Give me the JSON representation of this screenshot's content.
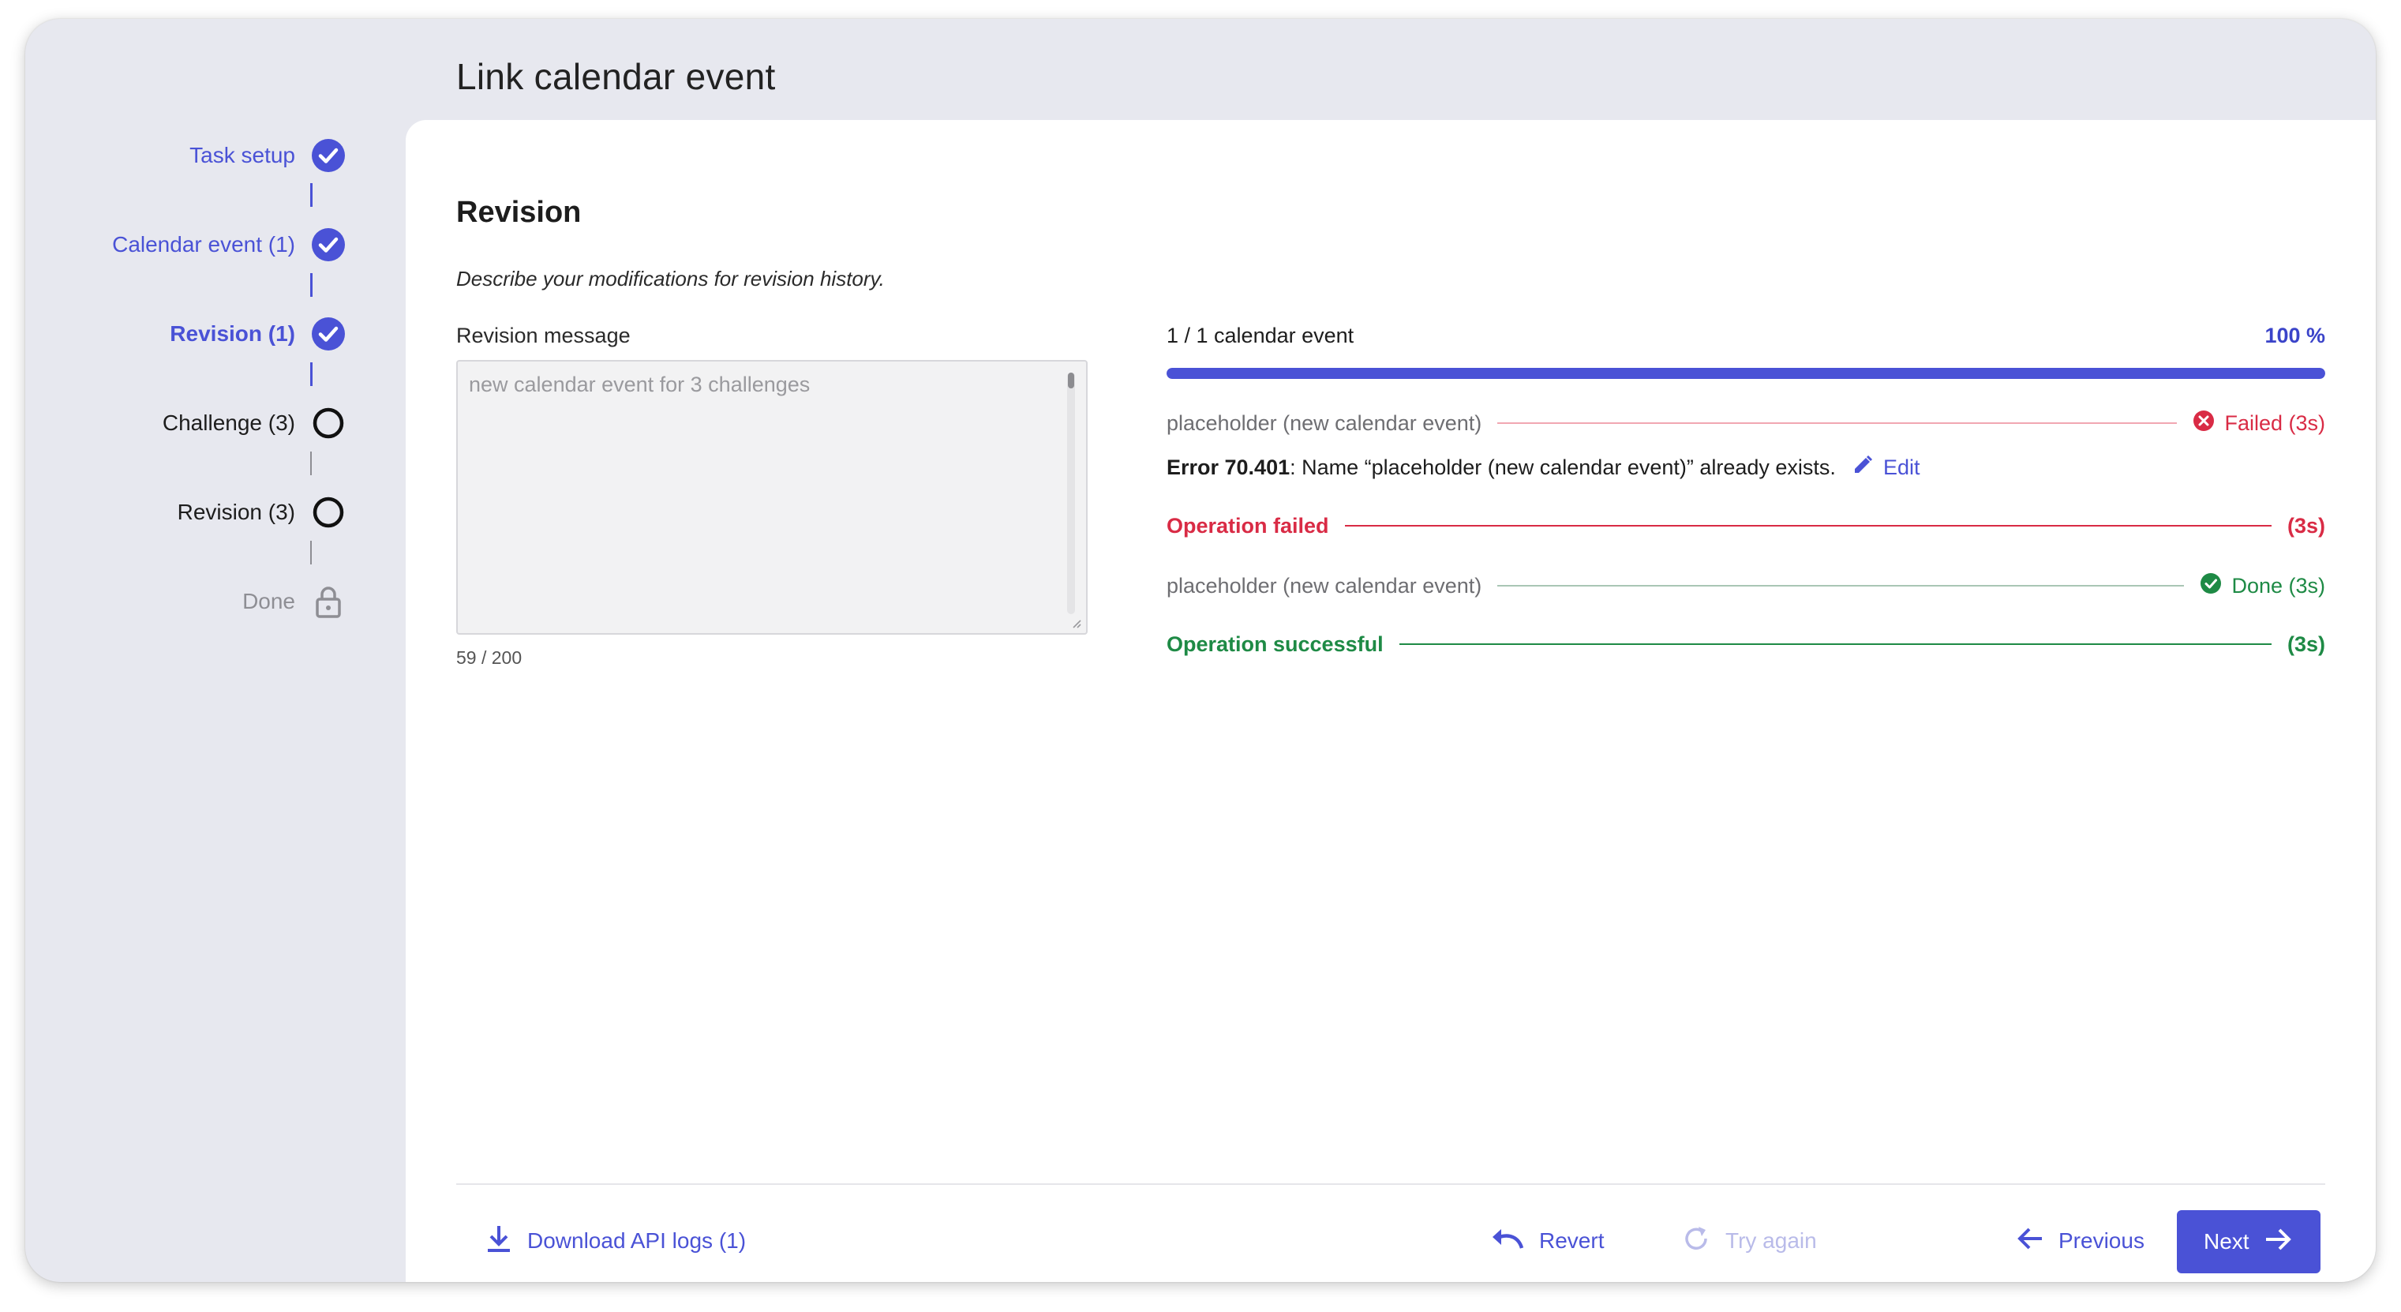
{
  "page": {
    "title": "Link calendar event"
  },
  "stepper": {
    "steps": [
      {
        "label": "Task setup",
        "state": "done"
      },
      {
        "label": "Calendar event (1)",
        "state": "done"
      },
      {
        "label": "Revision (1)",
        "state": "current"
      },
      {
        "label": "Challenge (3)",
        "state": "todo"
      },
      {
        "label": "Revision (3)",
        "state": "todo"
      },
      {
        "label": "Done",
        "state": "locked"
      }
    ]
  },
  "revision": {
    "title": "Revision",
    "description": "Describe your modifications for revision history.",
    "message_label": "Revision message",
    "message_placeholder": "new calendar event for 3 challenges",
    "char_count": "59 / 200"
  },
  "progress": {
    "label": "1 / 1 calendar event",
    "percent_text": "100 %",
    "fraction": 1.0,
    "color": "#4a52d6"
  },
  "operations": {
    "failed": {
      "item_name": "placeholder (new calendar event)",
      "item_status": "Failed (3s)",
      "error_code": "Error 70.401",
      "error_message": ": Name “placeholder (new calendar event)” already exists.",
      "edit_label": "Edit",
      "summary_label": "Operation failed",
      "summary_time": "(3s)",
      "color": "#d92b45"
    },
    "success": {
      "item_name": "placeholder (new calendar event)",
      "item_status": "Done (3s)",
      "summary_label": "Operation successful",
      "summary_time": "(3s)",
      "color": "#1e8a45"
    }
  },
  "footer": {
    "download_label": "Download API logs (1)",
    "revert_label": "Revert",
    "try_again_label": "Try again",
    "previous_label": "Previous",
    "next_label": "Next"
  },
  "icons": {
    "step_done": "check-circle-icon",
    "step_todo": "empty-circle-icon",
    "step_locked": "lock-icon",
    "failed": "x-circle-icon",
    "done": "check-circle-icon",
    "edit": "pencil-icon",
    "download": "download-icon",
    "revert": "undo-icon",
    "try_again": "refresh-icon",
    "previous": "arrow-left-icon",
    "next": "arrow-right-icon"
  },
  "colors": {
    "accent": "#4a52d6",
    "sidebar_bg": "#e7e8ef",
    "error": "#d92b45",
    "success": "#1e8a45"
  }
}
